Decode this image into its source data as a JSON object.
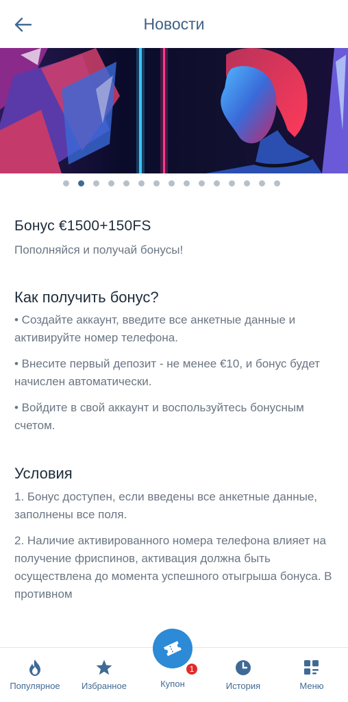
{
  "header": {
    "title": "Новости",
    "back_icon": "arrow-left-icon"
  },
  "carousel": {
    "total_slides": 15,
    "active_index": 1
  },
  "promo": {
    "title": "Бонус €1500+150FS",
    "subtitle": "Пополняйся и получай бонусы!"
  },
  "how_to": {
    "title": "Как получить бонус?",
    "items": [
      "• Создайте аккаунт, введите все анкетные данные и активируйте номер телефона.",
      "• Внесите первый депозит - не менее €10, и бонус будет начислен автоматически.",
      "• Войдите в свой аккаунт и воспользуйтесь бонусным счетом."
    ]
  },
  "conditions": {
    "title": "Условия",
    "items": [
      "1. Бонус доступен, если введены все анкетные данные, заполнены все поля.",
      "2. Наличие активированного номера телефона влияет на получение фриспинов, активация должна быть осуществлена до момента успешного отыгрыша бонуса. В противном"
    ]
  },
  "bottom_nav": {
    "items": [
      {
        "label": "Популярное",
        "icon": "flame-icon"
      },
      {
        "label": "Избранное",
        "icon": "star-icon"
      },
      {
        "label": "Купон",
        "icon": "ticket-icon",
        "badge": "1"
      },
      {
        "label": "История",
        "icon": "clock-icon"
      },
      {
        "label": "Меню",
        "icon": "menu-grid-icon"
      }
    ]
  },
  "colors": {
    "primary_text": "#1d2b3a",
    "secondary_text": "#6a7582",
    "accent": "#3f6a95",
    "coupon_button": "#2c8ad6",
    "badge": "#e02b2b"
  }
}
